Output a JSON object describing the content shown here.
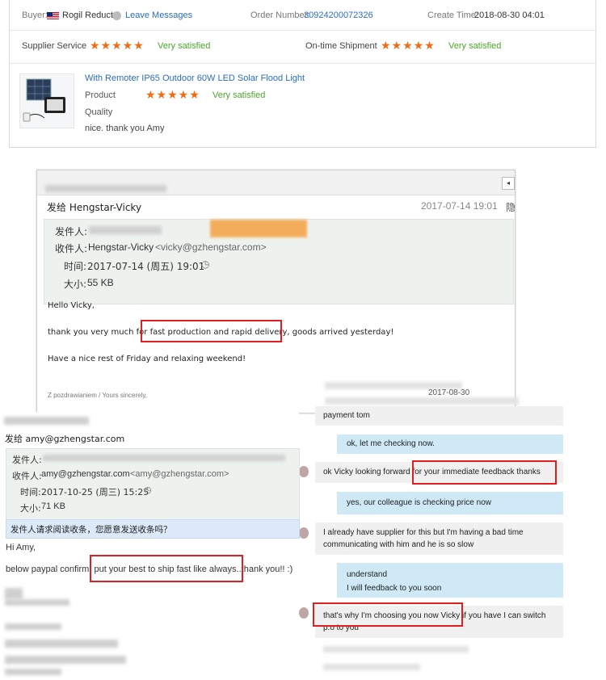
{
  "review": {
    "buyer_label": "Buyer:",
    "buyer_name": "Rogil Reducto",
    "leave_messages": "Leave Messages",
    "order_label": "Order Number:",
    "order_number": "30924200072326",
    "create_label": "Create Time:",
    "create_time": "2018-08-30 04:01",
    "supplier_service_label": "Supplier Service",
    "ontime_label": "On-time Shipment",
    "satisfied": "Very satisfied",
    "stars": "★★★★★",
    "product_title": "With Remoter IP65 Outdoor 60W LED Solar Flood Light",
    "product_label": "Product",
    "quality_label": "Quality",
    "comment": "nice. thank you Amy",
    "star_rating": 5
  },
  "email1": {
    "to_line": "发给 Hengstar-Vicky",
    "date": "2017-07-14 19:01",
    "hide": "隐",
    "from_label": "发件人:",
    "to_label": "收件人:",
    "to_value": "Hengstar-Vicky",
    "to_email": "<vicky@gzhengstar.com>",
    "time_label": "时间:",
    "time_value": "2017-07-14 (周五) 19:01",
    "size_label": "大小:",
    "size_value": "55 KB",
    "greeting": "Hello Vicky,",
    "line1_pre": "thank you very much for ",
    "line1_highlight": "fast production and rapid delivery,",
    "line1_post": " goods arrived yesterday!",
    "line2": "Have a nice rest of Friday and relaxing weekend!",
    "signature": "Z pozdrawianiem / Yours sincerely,"
  },
  "email2": {
    "to_line": "发给 amy@gzhengstar.com",
    "from_label": "发件人:",
    "to_label": "收件人:",
    "to_value": "amy@gzhengstar.com",
    "to_email": "<amy@gzhengstar.com>",
    "time_label": "时间:",
    "time_value": "2017-10-25 (周三) 15:25",
    "size_label": "大小:",
    "size_value": "71 KB",
    "notice": "发件人请求阅读收条，您愿意发送收条吗？",
    "greeting": "Hi Amy,",
    "line1_pre": "below paypal confirm; ",
    "line1_highlight": "put your best to ship fast like always.",
    "line1_post": ".thank you!! :)"
  },
  "chat": {
    "date": "2017-08-30",
    "messages": [
      {
        "side": "left",
        "text": "payment tom"
      },
      {
        "side": "right",
        "text": "ok, let me checking now."
      },
      {
        "side": "left",
        "text_pre": "ok Vicky looking forward ",
        "text_highlight": "for your immediate feedback thanks"
      },
      {
        "side": "right",
        "text": "yes, our colleague is checking price now"
      },
      {
        "side": "left",
        "text": "I already have supplier for this but I'm having a bad time communicating with him and he is so slow"
      },
      {
        "side": "right",
        "text_line1": "understand",
        "text_line2": "I will feedback to you soon"
      },
      {
        "side": "left",
        "text_highlight": "that's why I'm choosing you now Vicky",
        "text_post": " if you have I can switch p.o to you"
      }
    ]
  }
}
